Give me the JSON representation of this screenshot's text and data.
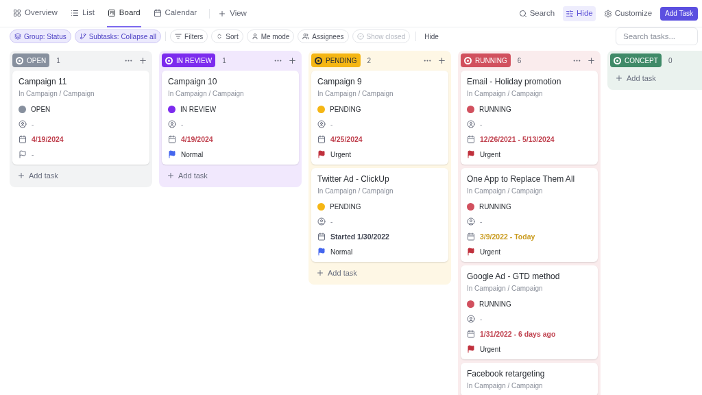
{
  "tabs": [
    {
      "label": "Overview",
      "selected": false
    },
    {
      "label": "List",
      "selected": false
    },
    {
      "label": "Board",
      "selected": true
    },
    {
      "label": "Calendar",
      "selected": false
    }
  ],
  "add_view": "View",
  "top_actions": [
    {
      "label": "Search",
      "selected": false
    },
    {
      "label": "Hide",
      "selected": true
    },
    {
      "label": "Customize",
      "selected": false
    }
  ],
  "add_task_button": "Add Task",
  "filters": [
    {
      "label": "Group: Status",
      "selected": true,
      "disabled": false
    },
    {
      "label": "Subtasks: Collapse all",
      "selected": true,
      "disabled": false
    },
    {
      "label": "Filters",
      "selected": false,
      "disabled": false
    },
    {
      "label": "Sort",
      "selected": false,
      "disabled": false
    },
    {
      "label": "Me mode",
      "selected": false,
      "disabled": false
    },
    {
      "label": "Assignees",
      "selected": false,
      "disabled": false
    },
    {
      "label": "Show closed",
      "selected": false,
      "disabled": true
    }
  ],
  "hide_link": "Hide",
  "search": {
    "placeholder": "Search tasks..."
  },
  "columns": [
    {
      "status": "OPEN",
      "count": "1",
      "color": "#87909e",
      "add_task": "Add task",
      "cards": [
        {
          "title": "Campaign 11",
          "path": "In Campaign / Campaign",
          "status": "OPEN",
          "assignee": "-",
          "date": {
            "text": "4/19/2024",
            "color": "#c0424f"
          },
          "priority": {
            "label": "-"
          }
        }
      ]
    },
    {
      "status": "IN REVIEW",
      "count": "1",
      "color": "#7c2bee",
      "add_task": "Add task",
      "cards": [
        {
          "title": "Campaign 10",
          "path": "In Campaign / Campaign",
          "status": "IN REVIEW",
          "assignee": "-",
          "date": {
            "text": "4/19/2024",
            "color": "#c0424f"
          },
          "priority": {
            "label": "Normal",
            "color": "#4466ee"
          }
        }
      ]
    },
    {
      "status": "PENDING",
      "count": "2",
      "color": "#f5b614",
      "add_task": "Add task",
      "cards": [
        {
          "title": "Campaign 9",
          "path": "In Campaign / Campaign",
          "status": "PENDING",
          "assignee": "-",
          "date": {
            "text": "4/25/2024",
            "color": "#c0424f"
          },
          "priority": {
            "label": "Urgent",
            "color": "#c0303c"
          }
        },
        {
          "title": "Twitter Ad - ClickUp",
          "path": "In Campaign / Campaign",
          "status": "PENDING",
          "assignee": "-",
          "date": {
            "text": "Started 1/30/2022",
            "color": "#3f4350"
          },
          "priority": {
            "label": "Normal",
            "color": "#4466ee"
          }
        }
      ]
    },
    {
      "status": "RUNNING",
      "count": "6",
      "color": "#d1505e",
      "cards": [
        {
          "title": "Email - Holiday promotion",
          "path": "In Campaign / Campaign",
          "status": "RUNNING",
          "assignee": "-",
          "date": {
            "text": "12/26/2021 - 5/13/2024",
            "color": "#c0424f"
          },
          "priority": {
            "label": "Urgent",
            "color": "#c0303c"
          }
        },
        {
          "title": "One App to Replace Them All",
          "path": "In Campaign / Campaign",
          "status": "RUNNING",
          "assignee": "-",
          "date": {
            "text": "3/9/2022 - Today",
            "color": "#c99a1c"
          },
          "priority": {
            "label": "Urgent",
            "color": "#c0303c"
          }
        },
        {
          "title": "Google Ad - GTD method",
          "path": "In Campaign / Campaign",
          "status": "RUNNING",
          "assignee": "-",
          "date": {
            "text": "1/31/2022 - 6 days ago",
            "color": "#c0424f"
          },
          "priority": {
            "label": "Urgent",
            "color": "#c0303c"
          }
        },
        {
          "title": "Facebook retargeting",
          "path": "In Campaign / Campaign"
        }
      ]
    },
    {
      "status": "CONCEPT",
      "count": "0",
      "color": "#3f8a68",
      "add_task": "Add task"
    }
  ]
}
